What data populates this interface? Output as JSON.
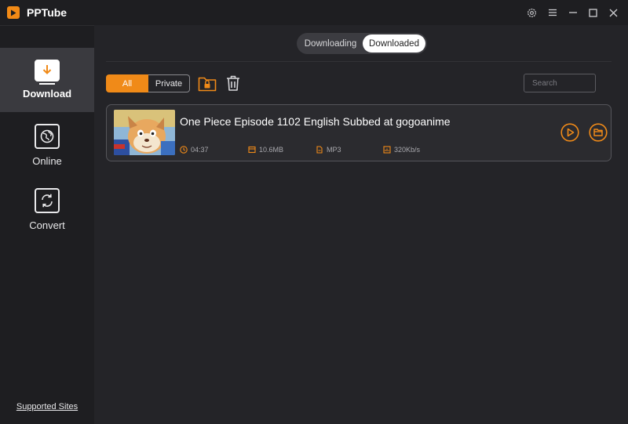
{
  "app": {
    "title": "PPTube"
  },
  "window_controls": [
    "gear-icon",
    "menu-icon",
    "minimize-icon",
    "maximize-icon",
    "close-icon"
  ],
  "sidebar": {
    "items": [
      {
        "label": "Download",
        "icon": "download-icon",
        "active": true
      },
      {
        "label": "Online",
        "icon": "globe-icon",
        "active": false
      },
      {
        "label": "Convert",
        "icon": "convert-icon",
        "active": false
      }
    ],
    "supported_sites": "Supported Sites"
  },
  "tabs": [
    {
      "label": "Downloading",
      "active": false
    },
    {
      "label": "Downloaded",
      "active": true
    }
  ],
  "filter": {
    "all_label": "All",
    "private_label": "Private",
    "selected": "All"
  },
  "search": {
    "placeholder": "Search",
    "value": ""
  },
  "items": [
    {
      "title": "One Piece Episode 1102 English Subbed at gogoanime",
      "duration": "04:37",
      "size": "10.6MB",
      "format": "MP3",
      "bitrate": "320Kb/s"
    }
  ],
  "colors": {
    "accent": "#f08a18",
    "background": "#242428",
    "sidebar": "#1e1e21",
    "card": "#2b2b2f"
  }
}
